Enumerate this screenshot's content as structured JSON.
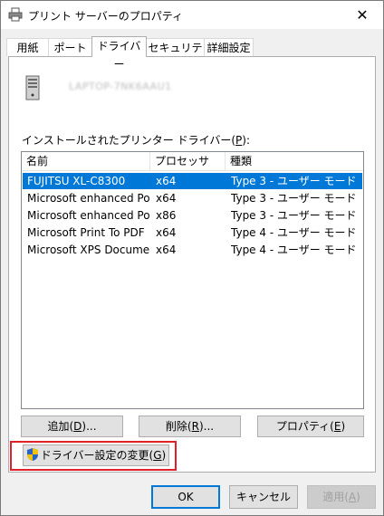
{
  "window": {
    "title": "プリント サーバーのプロパティ",
    "close_symbol": "✕"
  },
  "tabs": [
    {
      "label": "用紙"
    },
    {
      "label": "ポート"
    },
    {
      "label": "ドライバー"
    },
    {
      "label": "セキュリティ"
    },
    {
      "label": "詳細設定"
    }
  ],
  "server": {
    "name": "LAPTOP-7NK6AAU1"
  },
  "drivers_label": "インストールされたプリンター ドライバー(",
  "drivers_label_key": "P",
  "drivers_label_end": "):",
  "table": {
    "columns": [
      "名前",
      "プロセッサ",
      "種類"
    ],
    "rows": [
      {
        "name": "FUJITSU XL-C8300",
        "processor": "x64",
        "type": "Type 3 - ユーザー モード"
      },
      {
        "name": "Microsoft enhanced Poi...",
        "processor": "x64",
        "type": "Type 3 - ユーザー モード"
      },
      {
        "name": "Microsoft enhanced Poi...",
        "processor": "x86",
        "type": "Type 3 - ユーザー モード"
      },
      {
        "name": "Microsoft Print To PDF",
        "processor": "x64",
        "type": "Type 4 - ユーザー モード"
      },
      {
        "name": "Microsoft XPS Documen...",
        "processor": "x64",
        "type": "Type 4 - ユーザー モード"
      }
    ],
    "selected_index": 0
  },
  "buttons": {
    "add": {
      "pre": "追加(",
      "key": "D",
      "post": ")..."
    },
    "remove": {
      "pre": "削除(",
      "key": "R",
      "post": ")..."
    },
    "properties": {
      "pre": "プロパティ(",
      "key": "E",
      "post": ")"
    },
    "change_settings": {
      "pre": "ドライバー設定の変更(",
      "key": "G",
      "post": ")"
    },
    "ok": "OK",
    "cancel": "キャンセル",
    "apply": {
      "pre": "適用(",
      "key": "A",
      "post": ")"
    }
  },
  "colors": {
    "selection": "#0078d7",
    "highlight_border": "#e0202a"
  }
}
